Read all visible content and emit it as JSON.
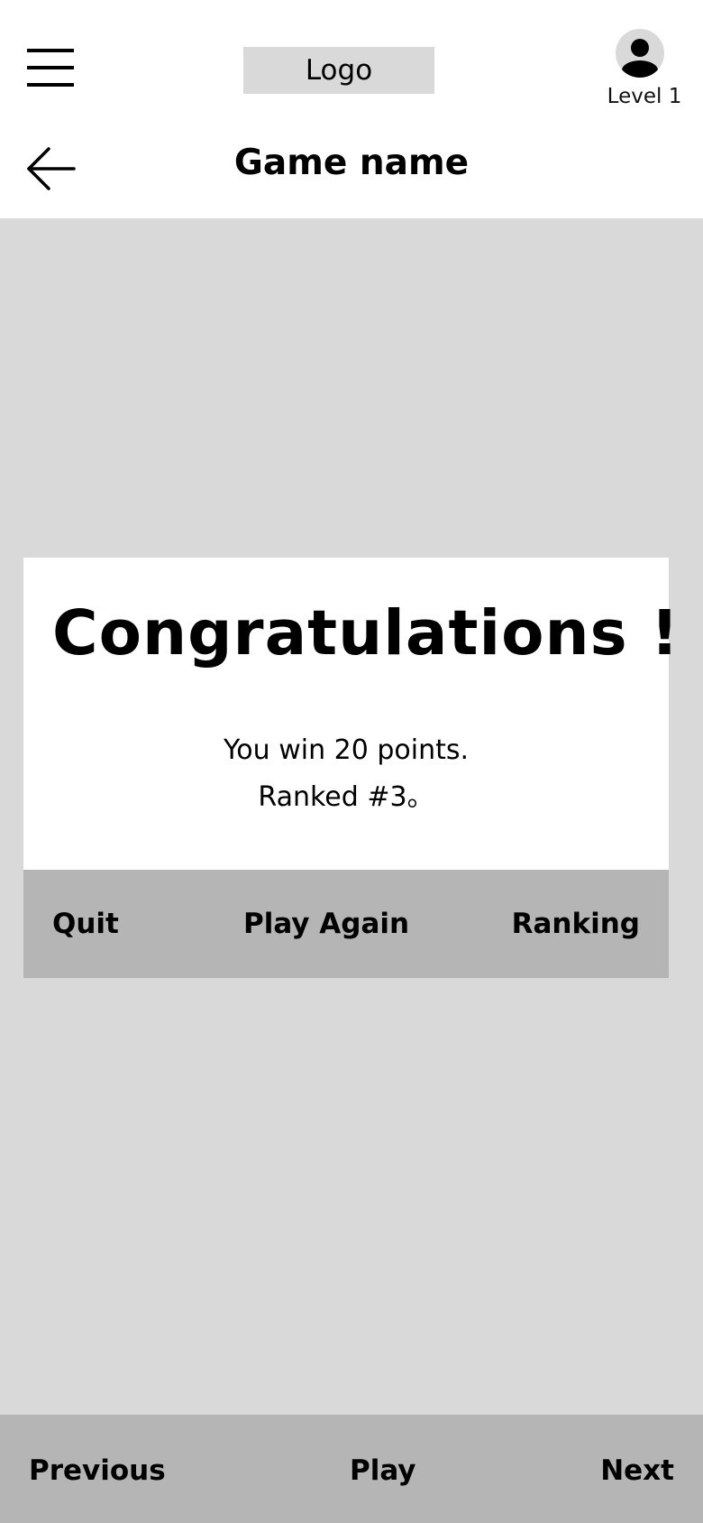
{
  "header": {
    "logo_text": "Logo",
    "level_text": "Level 1",
    "game_name": "Game name",
    "icons": {
      "menu": "hamburger-menu-icon",
      "avatar": "user-avatar-icon",
      "back": "arrow-left-icon"
    }
  },
  "result": {
    "title": "Congratulations !",
    "points_text": "You win 20 points.",
    "rank_text": "Ranked #3。"
  },
  "actions": {
    "quit_label": "Quit",
    "play_again_label": "Play Again",
    "ranking_label": "Ranking"
  },
  "bottom_nav": {
    "previous_label": "Previous",
    "play_label": "Play",
    "next_label": "Next"
  },
  "colors": {
    "page_background": "#d9d9d9",
    "panel_background": "#ffffff",
    "bar_background": "#b5b5b5",
    "text": "#000000"
  }
}
